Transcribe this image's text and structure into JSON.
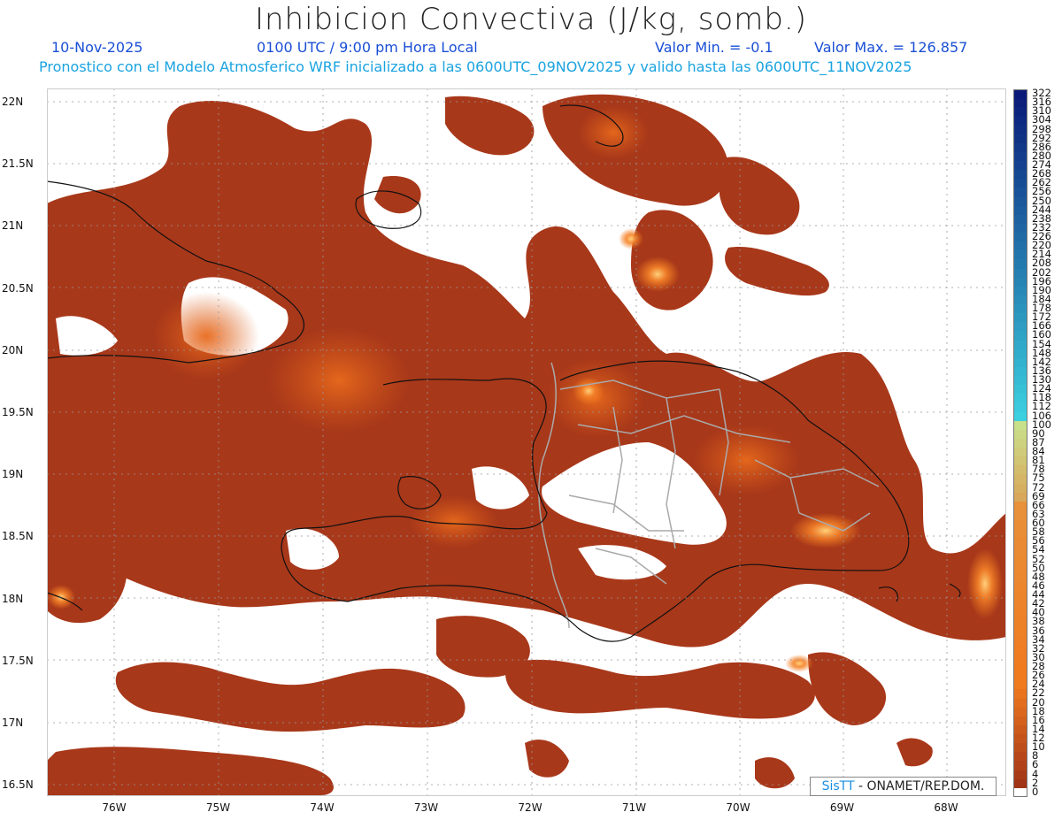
{
  "title": "Inhibicion Convectiva (J/kg, somb.)",
  "date": "10-Nov-2025",
  "time": "0100 UTC / 9:00 pm Hora Local",
  "valmin": "Valor Min. = -0.1",
  "valmax": "Valor Max. = 126.857",
  "model_line": "Pronostico con el Modelo Atmosferico WRF inicializado a las 0600UTC_09NOV2025 y valido hasta las  0600UTC_11NOV2025",
  "lat_labels": [
    "22N",
    "21.5N",
    "21N",
    "20.5N",
    "20N",
    "19.5N",
    "19N",
    "18.5N",
    "18N",
    "17.5N",
    "17N",
    "16.5N"
  ],
  "lon_labels": [
    "76W",
    "75W",
    "74W",
    "73W",
    "72W",
    "71W",
    "70W",
    "69W",
    "68W"
  ],
  "colorbar": {
    "labels": [
      "322",
      "316",
      "310",
      "304",
      "298",
      "292",
      "286",
      "280",
      "274",
      "268",
      "262",
      "256",
      "250",
      "244",
      "238",
      "232",
      "226",
      "220",
      "214",
      "208",
      "202",
      "196",
      "190",
      "184",
      "178",
      "172",
      "166",
      "160",
      "154",
      "148",
      "142",
      "136",
      "130",
      "124",
      "118",
      "112",
      "106",
      "100",
      "90",
      "87",
      "84",
      "81",
      "78",
      "75",
      "72",
      "69",
      "66",
      "63",
      "60",
      "58",
      "56",
      "54",
      "52",
      "50",
      "48",
      "46",
      "44",
      "42",
      "40",
      "38",
      "36",
      "34",
      "32",
      "30",
      "28",
      "26",
      "24",
      "22",
      "20",
      "18",
      "16",
      "14",
      "12",
      "10",
      "8",
      "6",
      "4",
      "2",
      "0"
    ],
    "top_color": "#0a1a78",
    "mid_color": "#3ad0e0",
    "low_color": "#c9e08a",
    "orange_color": "#f07a1e",
    "red_color": "#9a2e16",
    "zero_color": "#ffffff"
  },
  "credit": {
    "sis": "SisTT",
    "text": " - ONAMET/REP.DOM."
  },
  "colors": {
    "field_base": "#a8381a",
    "field_bright": "#f07a1e",
    "coast": "#111111",
    "border": "#aaaaaa",
    "grid": "#999999"
  }
}
